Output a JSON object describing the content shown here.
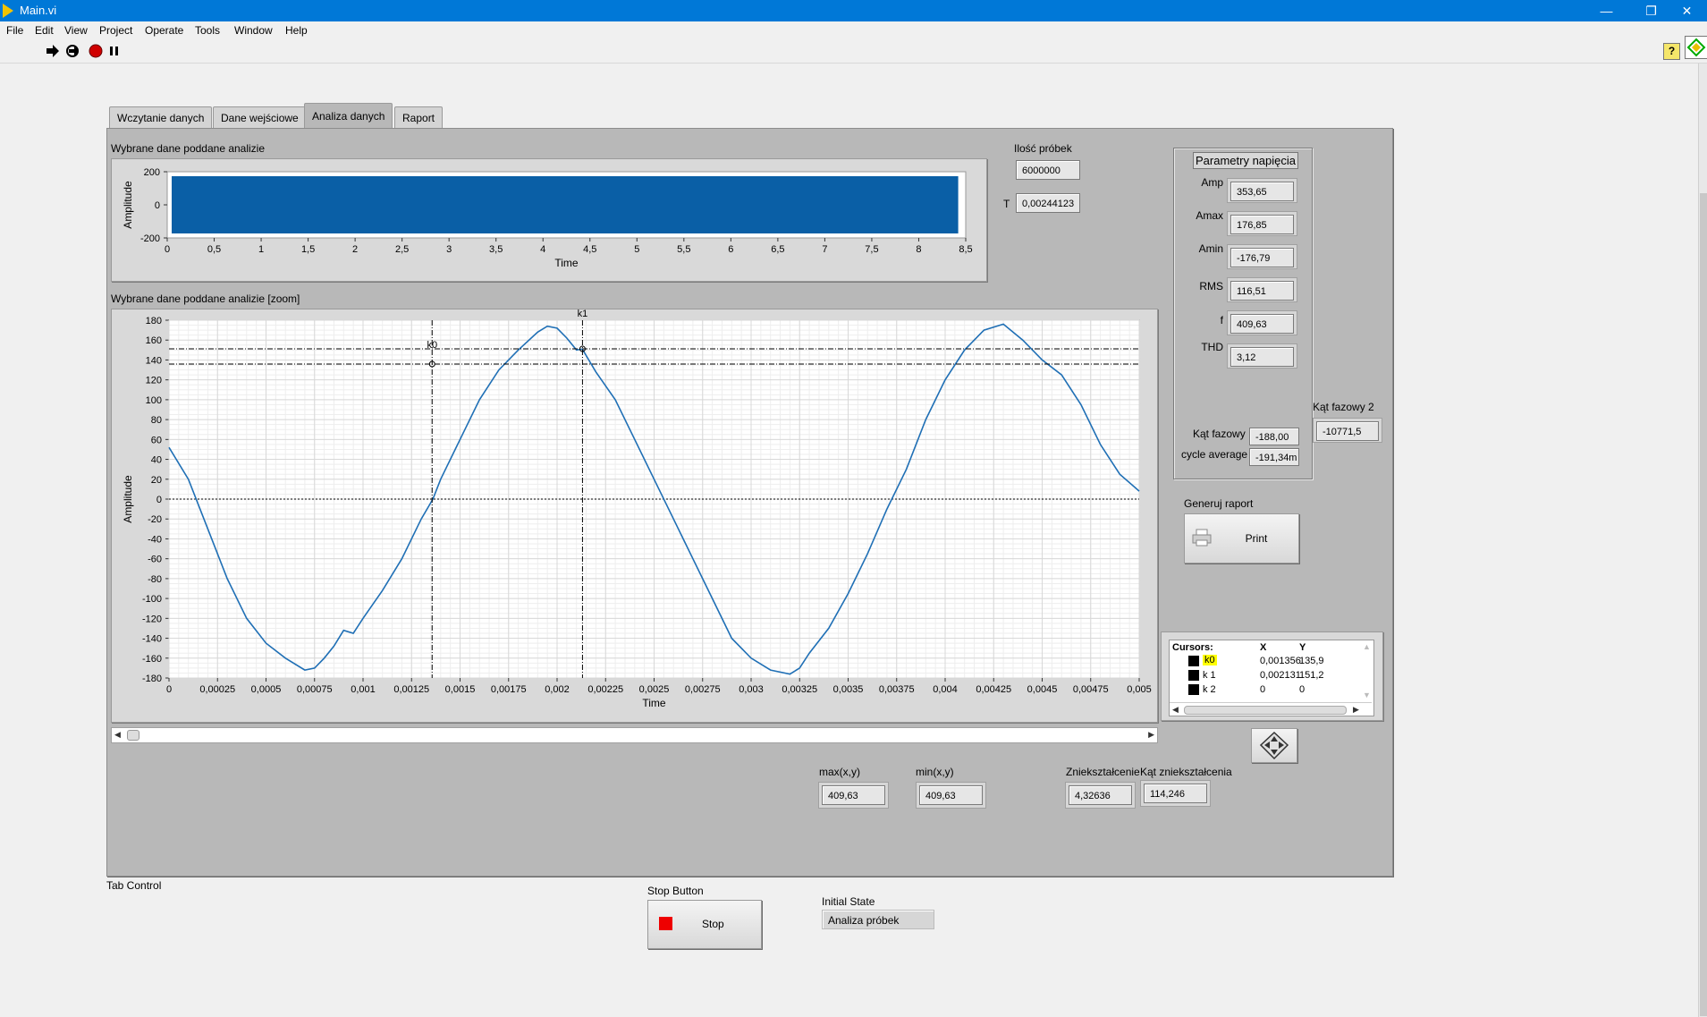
{
  "window": {
    "title": "Main.vi",
    "minimize": "—",
    "restore": "❐",
    "close": "✕"
  },
  "menu": [
    "File",
    "Edit",
    "View",
    "Project",
    "Operate",
    "Tools",
    "Window",
    "Help"
  ],
  "toolbar": {
    "run_icon": "run-arrow-icon",
    "run_cont_icon": "run-continuously-icon",
    "abort_icon": "abort-icon",
    "pause_icon": "pause-icon",
    "help_icon": "context-help-icon"
  },
  "tabs": [
    {
      "label": "Wczytanie danych",
      "active": false
    },
    {
      "label": "Dane wejściowe",
      "active": false
    },
    {
      "label": "Analiza danych",
      "active": true
    },
    {
      "label": "Raport",
      "active": false
    }
  ],
  "graph1": {
    "label": "Wybrane dane poddane analizie",
    "ylabel": "Amplitude",
    "xlabel": "Time",
    "yticks": [
      "200",
      "0",
      "-200"
    ],
    "xticks": [
      "0",
      "0,5",
      "1",
      "1,5",
      "2",
      "2,5",
      "3",
      "3,5",
      "4",
      "4,5",
      "5",
      "5,5",
      "6",
      "6,5",
      "7",
      "7,5",
      "8",
      "8,5"
    ]
  },
  "samples": {
    "label": "Ilość próbek",
    "value": "6000000",
    "t_label": "T",
    "t_value": "0,00244123"
  },
  "graph2": {
    "label": "Wybrane dane poddane analizie [zoom]",
    "ylabel": "Amplitude",
    "xlabel": "Time",
    "yticks": [
      "180",
      "160",
      "140",
      "120",
      "100",
      "80",
      "60",
      "40",
      "20",
      "0",
      "-20",
      "-40",
      "-60",
      "-80",
      "-100",
      "-120",
      "-140",
      "-160",
      "-180"
    ],
    "xticks": [
      "0",
      "0,00025",
      "0,0005",
      "0,00075",
      "0,001",
      "0,00125",
      "0,0015",
      "0,00175",
      "0,002",
      "0,00225",
      "0,0025",
      "0,00275",
      "0,003",
      "0,00325",
      "0,0035",
      "0,00375",
      "0,004",
      "0,00425",
      "0,0045",
      "0,00475",
      "0,005"
    ],
    "cursor_labels": [
      "k0",
      "k1"
    ]
  },
  "chart_data": {
    "type": "line",
    "xlabel": "Time",
    "ylabel": "Amplitude",
    "xlim": [
      0,
      0.005
    ],
    "ylim": [
      -180,
      180
    ],
    "grid": true,
    "series": [
      {
        "x": [
          0,
          0.0001,
          0.0002,
          0.0003,
          0.0004,
          0.0005,
          0.0006,
          0.0007,
          0.00075,
          0.0008,
          0.00085,
          0.0009,
          0.00095,
          0.001,
          0.0011,
          0.0012,
          0.0013,
          0.00136,
          0.0014,
          0.0015,
          0.0016,
          0.0017,
          0.0018,
          0.0019,
          0.00195,
          0.002,
          0.00205,
          0.0021,
          0.00213,
          0.0022,
          0.0023,
          0.0024,
          0.0025,
          0.0026,
          0.0027,
          0.0028,
          0.0029,
          0.003,
          0.0031,
          0.0032,
          0.00325,
          0.0033,
          0.0034,
          0.0035,
          0.0036,
          0.0037,
          0.0038,
          0.0039,
          0.004,
          0.0041,
          0.0042,
          0.0043,
          0.0044,
          0.0045,
          0.0046,
          0.0047,
          0.0048,
          0.0049,
          0.005
        ],
        "y": [
          52,
          20,
          -30,
          -80,
          -120,
          -145,
          -160,
          -172,
          -170,
          -160,
          -148,
          -132,
          -135,
          -120,
          -92,
          -60,
          -20,
          0,
          20,
          60,
          100,
          130,
          150,
          168,
          174,
          172,
          162,
          150,
          151,
          128,
          100,
          60,
          20,
          -20,
          -60,
          -100,
          -140,
          -160,
          -172,
          -176,
          -170,
          -155,
          -130,
          -95,
          -55,
          -10,
          30,
          80,
          120,
          150,
          170,
          176,
          160,
          140,
          125,
          95,
          55,
          25,
          8
        ]
      }
    ]
  },
  "params": {
    "title": "Parametry napięcia",
    "rows": [
      {
        "label": "Amp",
        "value": "353,65"
      },
      {
        "label": "Amax",
        "value": "176,85"
      },
      {
        "label": "Amin",
        "value": "-176,79"
      },
      {
        "label": "RMS",
        "value": "116,51"
      },
      {
        "label": "f",
        "value": "409,63"
      },
      {
        "label": "THD",
        "value": "3,12"
      }
    ],
    "phase_label": "Kąt fazowy",
    "phase_value": "-188,00",
    "cycle_label": "cycle average",
    "cycle_value": "-191,34m"
  },
  "phase2": {
    "label": "Kąt fazowy 2",
    "value": "-10771,5"
  },
  "report": {
    "label": "Generuj raport",
    "button": "Print",
    "icon": "printer-icon"
  },
  "cursors": {
    "headers": [
      "Cursors:",
      "X",
      "Y"
    ],
    "rows": [
      {
        "name": "k0",
        "x": "0,001356",
        "y": "135,9",
        "highlight": true
      },
      {
        "name": "k 1",
        "x": "0,002131",
        "y": "151,2",
        "highlight": false
      },
      {
        "name": "k 2",
        "x": "0",
        "y": "0",
        "highlight": false
      }
    ]
  },
  "measures": {
    "max_label": "max(x,y)",
    "max_value": "409,63",
    "min_label": "min(x,y)",
    "min_value": "409,63",
    "dist_label": "Zniekształcenie",
    "dist_value": "4,32636",
    "angle_label": "Kąt zniekształcenia",
    "angle_value": "114,246"
  },
  "bottom": {
    "tab_control_label": "Tab Control",
    "stop_label": "Stop Button",
    "stop_button": "Stop",
    "state_label": "Initial State",
    "state_value": "Analiza próbek"
  }
}
